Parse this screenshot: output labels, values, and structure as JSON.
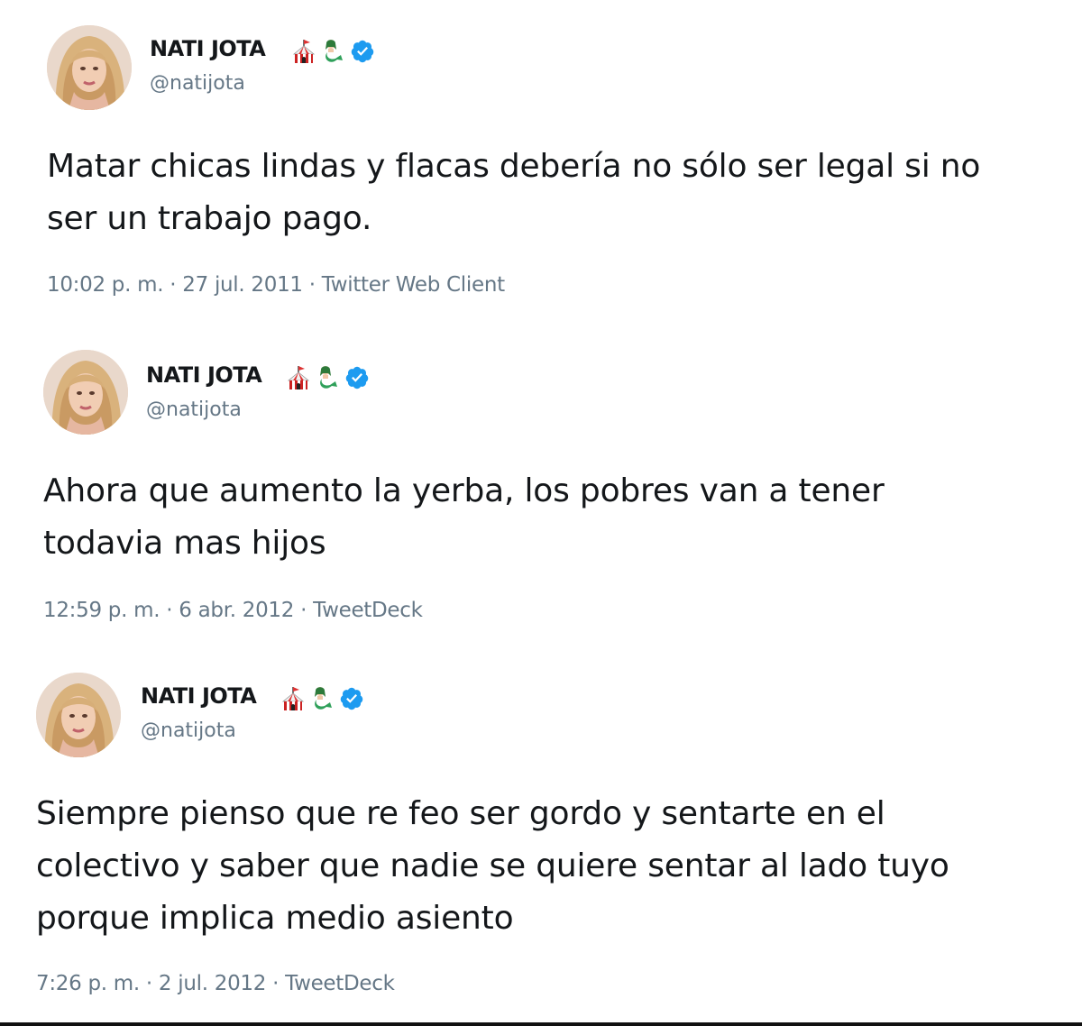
{
  "tweets": [
    {
      "display_name": "NATI JOTA",
      "handle": "@natijota",
      "text": "Matar chicas lindas y flacas debería no sólo ser legal si no ser un trabajo pago.",
      "meta": "10:02 p. m. · 27 jul. 2011 · Twitter Web Client",
      "icons": [
        "circus-tent-emoji",
        "mermaid-emoji",
        "verified-badge-icon"
      ]
    },
    {
      "display_name": "NATI JOTA",
      "handle": "@natijota",
      "text": "Ahora que aumento la yerba, los pobres van a tener todavia mas hijos",
      "meta": "12:59 p. m. · 6 abr. 2012 · TweetDeck",
      "icons": [
        "circus-tent-emoji",
        "mermaid-emoji",
        "verified-badge-icon"
      ]
    },
    {
      "display_name": "NATI JOTA",
      "handle": "@natijota",
      "text": "Siempre pienso que re feo ser gordo y sentarte en el colectivo y saber que nadie se quiere sentar al lado tuyo porque implica medio asiento",
      "meta": "7:26 p. m. · 2 jul. 2012 · TweetDeck",
      "icons": [
        "circus-tent-emoji",
        "mermaid-emoji",
        "verified-badge-icon"
      ]
    }
  ],
  "colors": {
    "text": "#14171a",
    "secondary": "#657786",
    "verified": "#1d9bf0"
  }
}
